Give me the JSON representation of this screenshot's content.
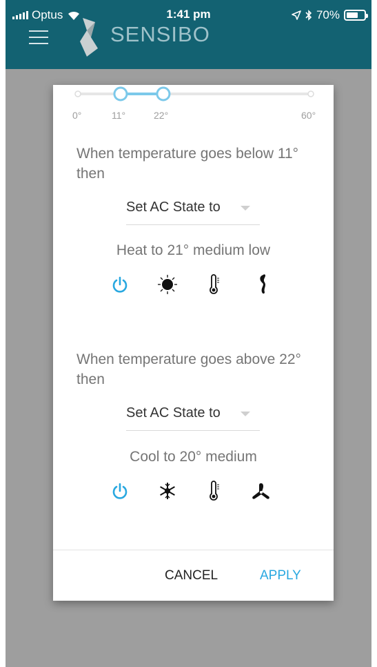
{
  "status_bar": {
    "carrier": "Optus",
    "time": "1:41 pm",
    "battery": "70%",
    "battery_level": 0.7
  },
  "header": {
    "brand": "SENSIBO",
    "menu_icon": "hamburger-menu-icon",
    "logo_icon": "sensibo-logo-icon",
    "color": "#136272"
  },
  "dialog": {
    "range_slider": {
      "min_label": "0°",
      "low_label": "11°",
      "high_label": "22°",
      "max_label": "60°",
      "min": 0,
      "max": 60,
      "low": 11,
      "high": 22,
      "active_color": "#7cc9ea"
    },
    "rules": [
      {
        "title": "When temperature goes below 11° then",
        "dropdown_value": "Set AC State to",
        "state": "Heat to 21° medium low",
        "icons": [
          "power-icon",
          "sun-icon",
          "thermometer-icon",
          "fan-low-icon"
        ]
      },
      {
        "title": "When temperature goes above 22° then",
        "dropdown_value": "Set AC State to",
        "state": "Cool to 20° medium",
        "icons": [
          "power-icon",
          "snowflake-icon",
          "thermometer-icon",
          "fan-icon"
        ]
      }
    ],
    "cancel_label": "CANCEL",
    "apply_label": "APPLY",
    "accent_color": "#29a8e0"
  }
}
